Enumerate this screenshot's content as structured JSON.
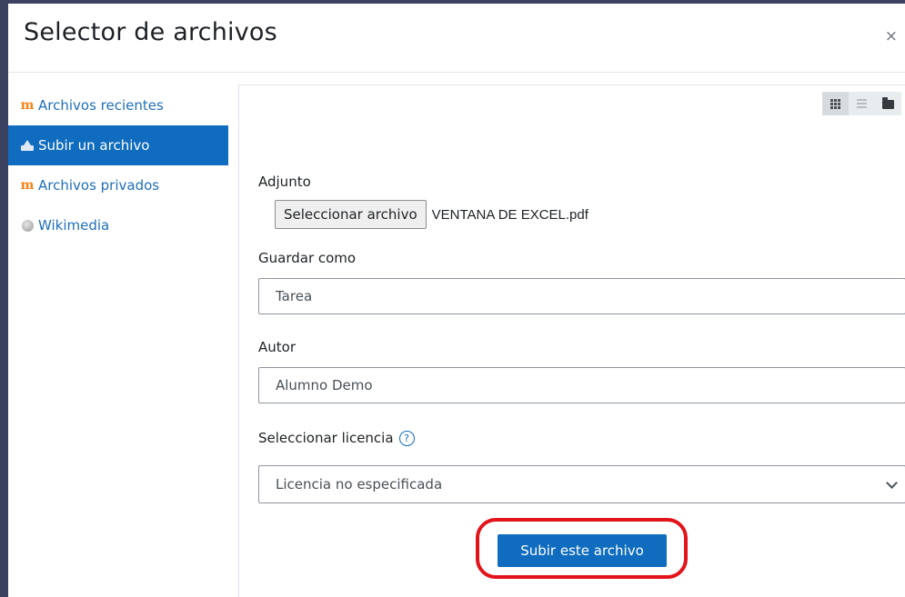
{
  "dialog": {
    "title": "Selector de archivos",
    "close_symbol": "×"
  },
  "sidebar": {
    "items": [
      {
        "label": "Archivos recientes",
        "icon": "moodle-icon",
        "active": false
      },
      {
        "label": "Subir un archivo",
        "icon": "upload-icon",
        "active": true
      },
      {
        "label": "Archivos privados",
        "icon": "moodle-icon",
        "active": false
      },
      {
        "label": "Wikimedia",
        "icon": "wikimedia-icon",
        "active": false
      }
    ]
  },
  "view_toggles": [
    "grid-view-icon",
    "list-view-icon",
    "folder-view-icon"
  ],
  "form": {
    "attachment_label": "Adjunto",
    "choose_file_button": "Seleccionar archivo",
    "file_name": "VENTANA DE EXCEL.pdf",
    "save_as_label": "Guardar como",
    "save_as_value": "Tarea",
    "author_label": "Autor",
    "author_value": "Alumno Demo",
    "license_label": "Seleccionar licencia",
    "license_value": "Licencia no especificada",
    "submit_button": "Subir este archivo"
  },
  "colors": {
    "primary": "#0f6cbf",
    "highlight": "#e3131a",
    "moodle_orange": "#f98012"
  }
}
